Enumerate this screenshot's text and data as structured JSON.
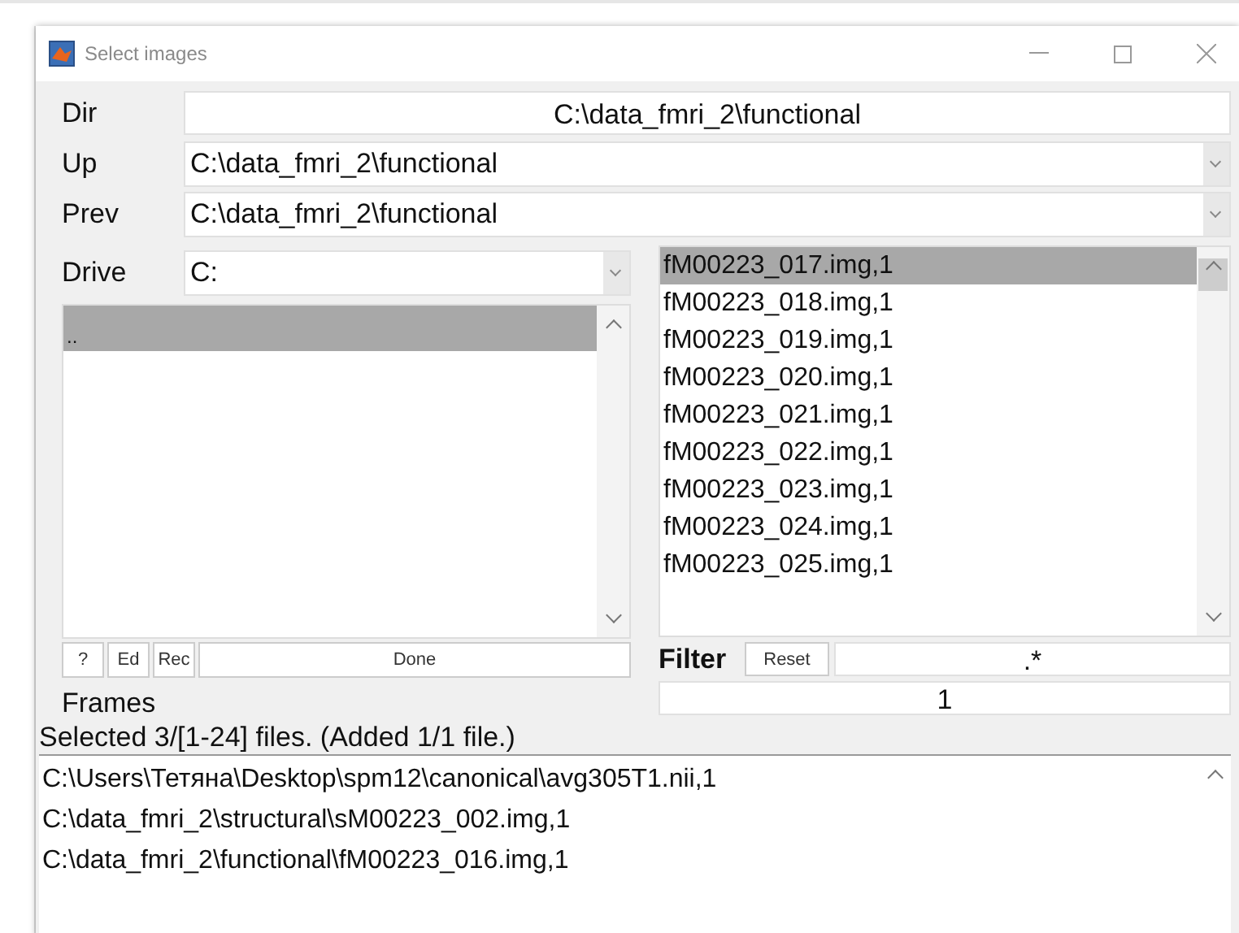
{
  "window": {
    "title": "Select images"
  },
  "dir": {
    "label": "Dir",
    "value": "C:\\data_fmri_2\\functional"
  },
  "up": {
    "label": "Up",
    "value": "C:\\data_fmri_2\\functional"
  },
  "prev": {
    "label": "Prev",
    "value": "C:\\data_fmri_2\\functional"
  },
  "drive": {
    "label": "Drive",
    "value": "C:"
  },
  "directories": [
    {
      "name": "..",
      "selected": true
    }
  ],
  "files": [
    {
      "name": "fM00223_017.img,1",
      "selected": true
    },
    {
      "name": "fM00223_018.img,1",
      "selected": false
    },
    {
      "name": "fM00223_019.img,1",
      "selected": false
    },
    {
      "name": "fM00223_020.img,1",
      "selected": false
    },
    {
      "name": "fM00223_021.img,1",
      "selected": false
    },
    {
      "name": "fM00223_022.img,1",
      "selected": false
    },
    {
      "name": "fM00223_023.img,1",
      "selected": false
    },
    {
      "name": "fM00223_024.img,1",
      "selected": false
    },
    {
      "name": "fM00223_025.img,1",
      "selected": false
    }
  ],
  "buttons": [
    {
      "label": "?",
      "kind": "small"
    },
    {
      "label": "Ed",
      "kind": "small"
    },
    {
      "label": "Rec",
      "kind": "small"
    },
    {
      "label": "Done",
      "kind": "wide"
    }
  ],
  "filter": {
    "label": "Filter",
    "reset": "Reset",
    "value": ".*"
  },
  "frames": {
    "label": "Frames",
    "value": "1"
  },
  "status": "Selected 3/[1-24] files. (Added 1/1 file.)",
  "selected_files": [
    "C:\\Users\\Тетяна\\Desktop\\spm12\\canonical\\avg305T1.nii,1",
    "C:\\data_fmri_2\\structural\\sM00223_002.img,1",
    "C:\\data_fmri_2\\functional\\fM00223_016.img,1"
  ]
}
